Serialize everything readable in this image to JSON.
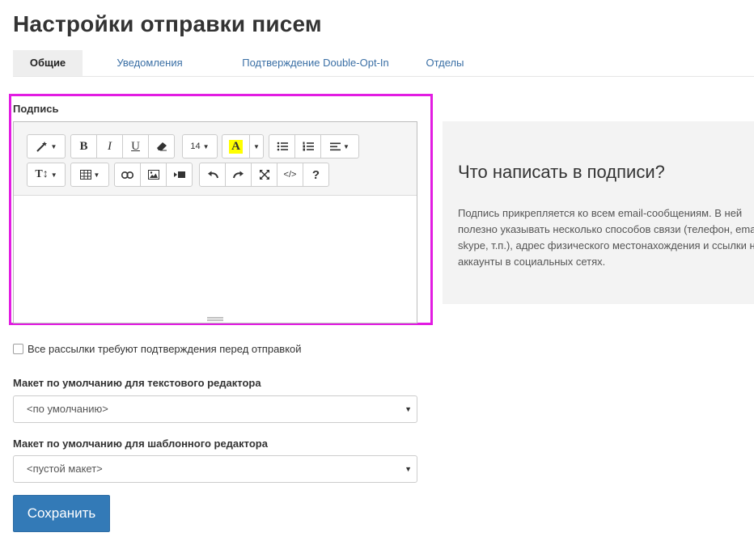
{
  "page": {
    "title": "Настройки отправки писем"
  },
  "tabs": [
    {
      "label": "Общие",
      "active": true
    },
    {
      "label": "Уведомления",
      "active": false
    },
    {
      "label": "Подтверждение Double-Opt-In",
      "active": false
    },
    {
      "label": "Отделы",
      "active": false
    }
  ],
  "signature": {
    "label": "Подпись",
    "toolbar": {
      "bold": "B",
      "italic": "I",
      "underline": "U",
      "font_size": "14",
      "highlight_letter": "A",
      "help": "?",
      "text_style": "T",
      "code": "</>",
      "highlight_color": "#ffff00"
    }
  },
  "info": {
    "title": "Что написать в подписи?",
    "lines": [
      "Подпись прикрепляется ко всем email-сообщениям. В ней",
      "полезно указывать несколько способов связи (телефон, email,",
      "skype, т.п.), адрес физического местонахождения и ссылки на",
      "аккаунты в социальных сетях."
    ]
  },
  "confirm_checkbox": {
    "label": "Все рассылки требуют подтверждения перед отправкой",
    "checked": false
  },
  "text_layout": {
    "label": "Макет по умолчанию для текстового редактора",
    "value": "<по умолчанию>"
  },
  "template_layout": {
    "label": "Макет по умолчанию для шаблонного редактора",
    "value": "<пустой макет>"
  },
  "save_button": {
    "label": "Сохранить"
  },
  "colors": {
    "accent": "#337ab7",
    "highlight_border": "#e21ce2",
    "tab_link": "#3a6fa5"
  }
}
